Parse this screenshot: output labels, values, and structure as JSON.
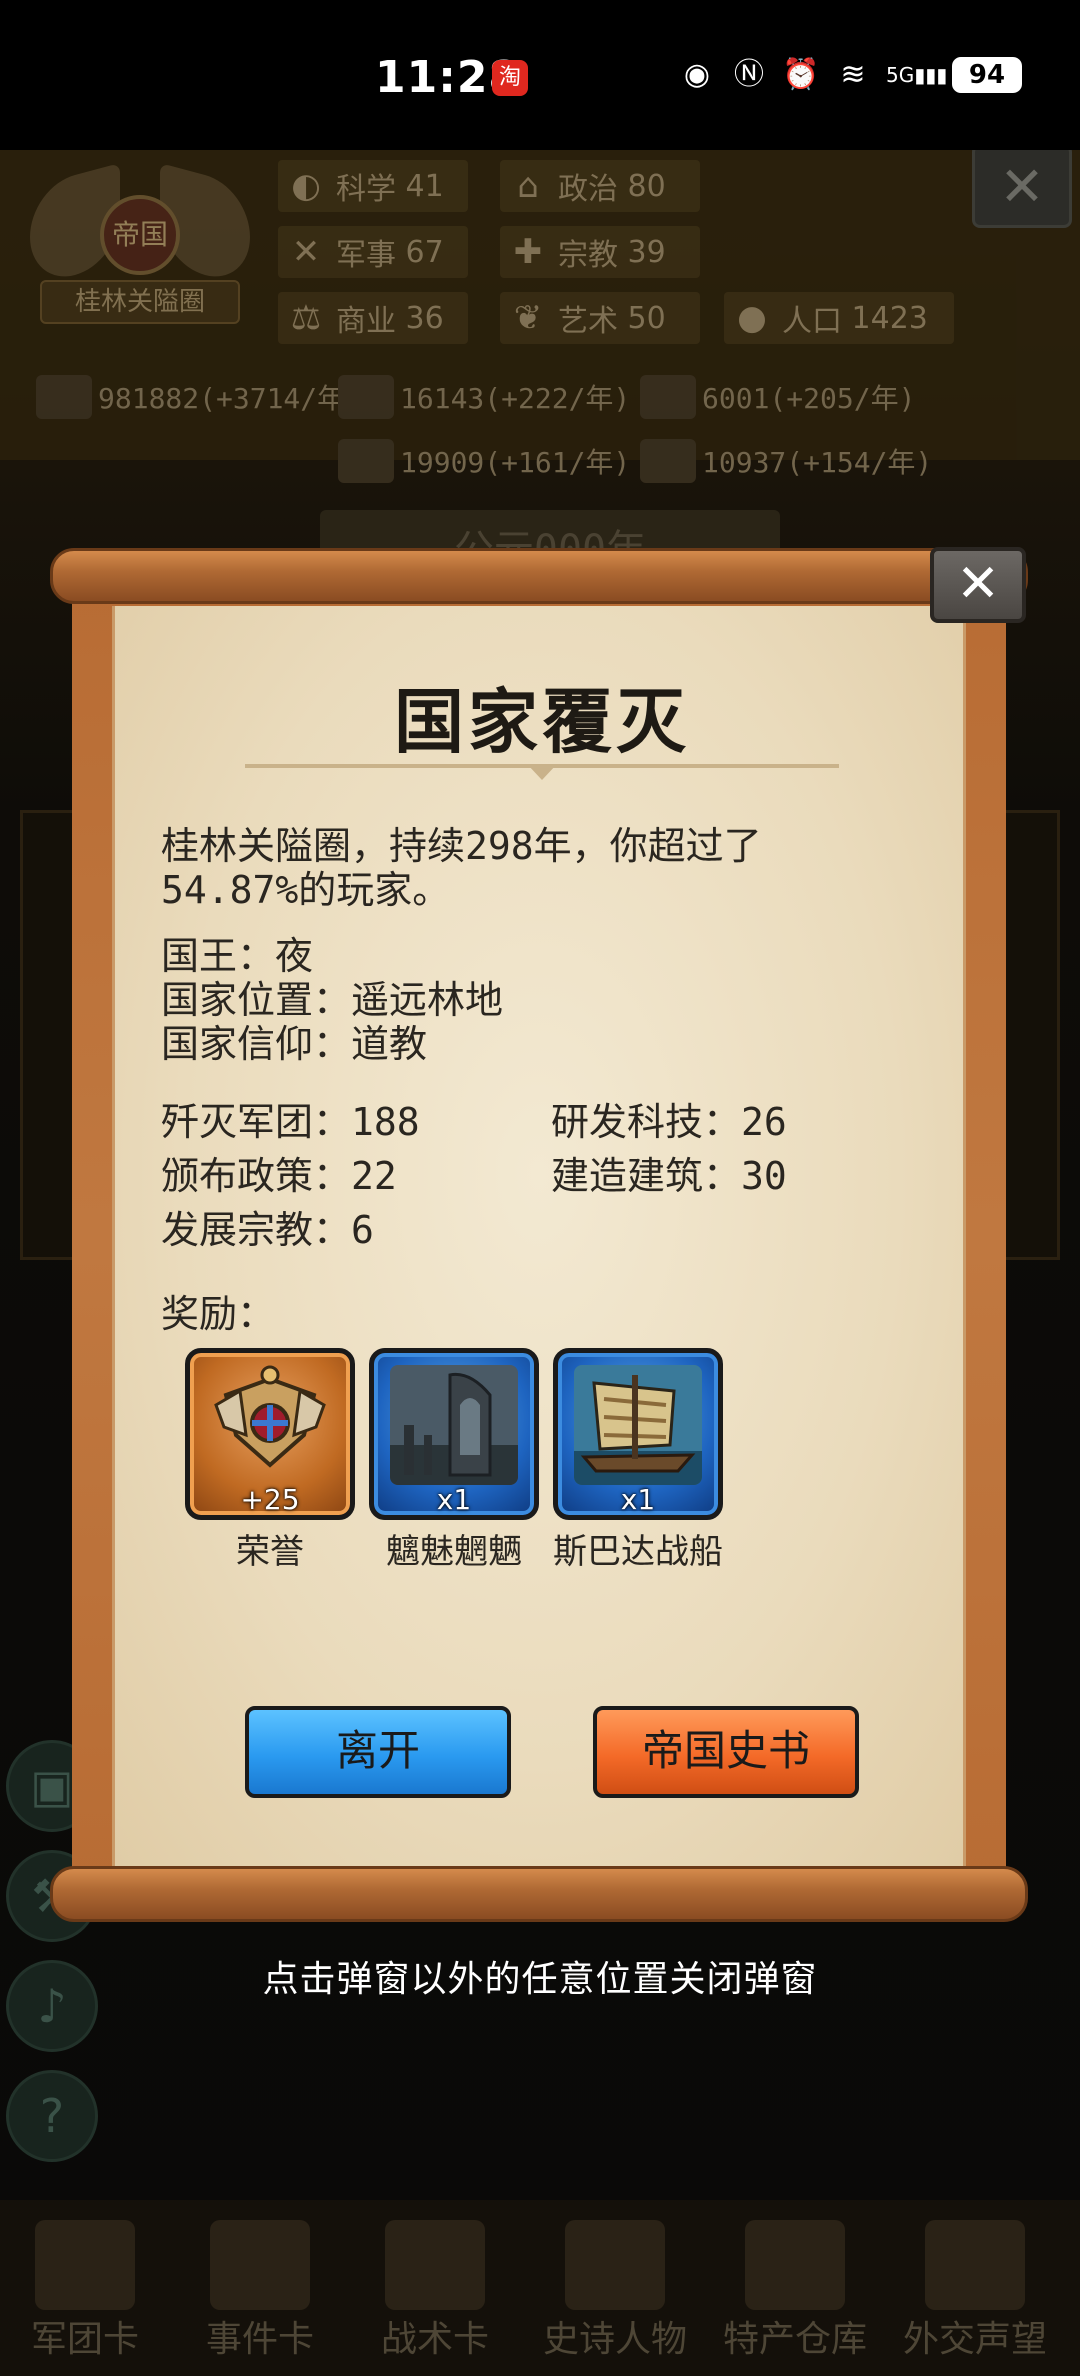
{
  "status_bar": {
    "time": "11:28",
    "app_badge": "淘",
    "network": "5G",
    "battery": "94"
  },
  "background": {
    "emblem": {
      "shield_text": "帝国",
      "nation_name": "桂林关隘圈"
    },
    "stats": [
      {
        "icon": "science-icon",
        "label": "科学",
        "value": "41"
      },
      {
        "icon": "politics-icon",
        "label": "政治",
        "value": "80"
      },
      {
        "icon": "military-icon",
        "label": "军事",
        "value": "67"
      },
      {
        "icon": "religion-icon",
        "label": "宗教",
        "value": "39"
      },
      {
        "icon": "commerce-icon",
        "label": "商业",
        "value": "36"
      },
      {
        "icon": "art-icon",
        "label": "艺术",
        "value": "50"
      },
      {
        "icon": "population-icon",
        "label": "人口",
        "value": "1423"
      }
    ],
    "resources": [
      {
        "icon": "gold-icon",
        "text": "981882(+3714/年)"
      },
      {
        "icon": "wood-icon",
        "text": "16143(+222/年)"
      },
      {
        "icon": "stone-icon",
        "text": "6001(+205/年)"
      },
      {
        "icon": "iron-icon",
        "text": "19909(+161/年)"
      },
      {
        "icon": "meat-icon",
        "text": "10937(+154/年)"
      }
    ],
    "year_banner": "公元000年",
    "nav": [
      {
        "icon": "legion-card-icon",
        "label": "军团卡"
      },
      {
        "icon": "event-card-icon",
        "label": "事件卡"
      },
      {
        "icon": "tactic-card-icon",
        "label": "战术卡"
      },
      {
        "icon": "epic-hero-icon",
        "label": "史诗人物"
      },
      {
        "icon": "warehouse-icon",
        "label": "特产仓库"
      },
      {
        "icon": "diplomacy-icon",
        "label": "外交声望"
      }
    ]
  },
  "dialog": {
    "title": "国家覆灭",
    "summary": "桂林关隘圈，持续298年，你超过了54.87%的玩家。",
    "info": [
      {
        "label": "国王",
        "sep": "：",
        "value": "夜"
      },
      {
        "label": "国家位置",
        "sep": "：",
        "value": "遥远林地"
      },
      {
        "label": "国家信仰",
        "sep": "：",
        "value": "道教"
      }
    ],
    "stats": [
      {
        "label": "歼灭军团",
        "value": "188"
      },
      {
        "label": "研发科技",
        "value": "26"
      },
      {
        "label": "颁布政策",
        "value": "22"
      },
      {
        "label": "建造建筑",
        "value": "30"
      },
      {
        "label": "发展宗教",
        "value": "6"
      }
    ],
    "rewards_label": "奖励：",
    "rewards": [
      {
        "name": "荣誉",
        "qty": "+25",
        "frame": "orange",
        "icon": "honor-medal-icon"
      },
      {
        "name": "魑魅魍魉",
        "qty": "x1",
        "frame": "blue",
        "icon": "ruins-card-icon"
      },
      {
        "name": "斯巴达战船",
        "qty": "x1",
        "frame": "blue",
        "icon": "warship-card-icon"
      }
    ],
    "buttons": {
      "leave": "离开",
      "history": "帝国史书"
    },
    "close_icon": "close-icon"
  },
  "hint": "点击弹窗以外的任意位置关闭弹窗",
  "colors": {
    "blue_button": "#2a9af0",
    "orange_button": "#f46a28",
    "parchment": "#eadbbc",
    "scroll_wood": "#b06a34"
  }
}
